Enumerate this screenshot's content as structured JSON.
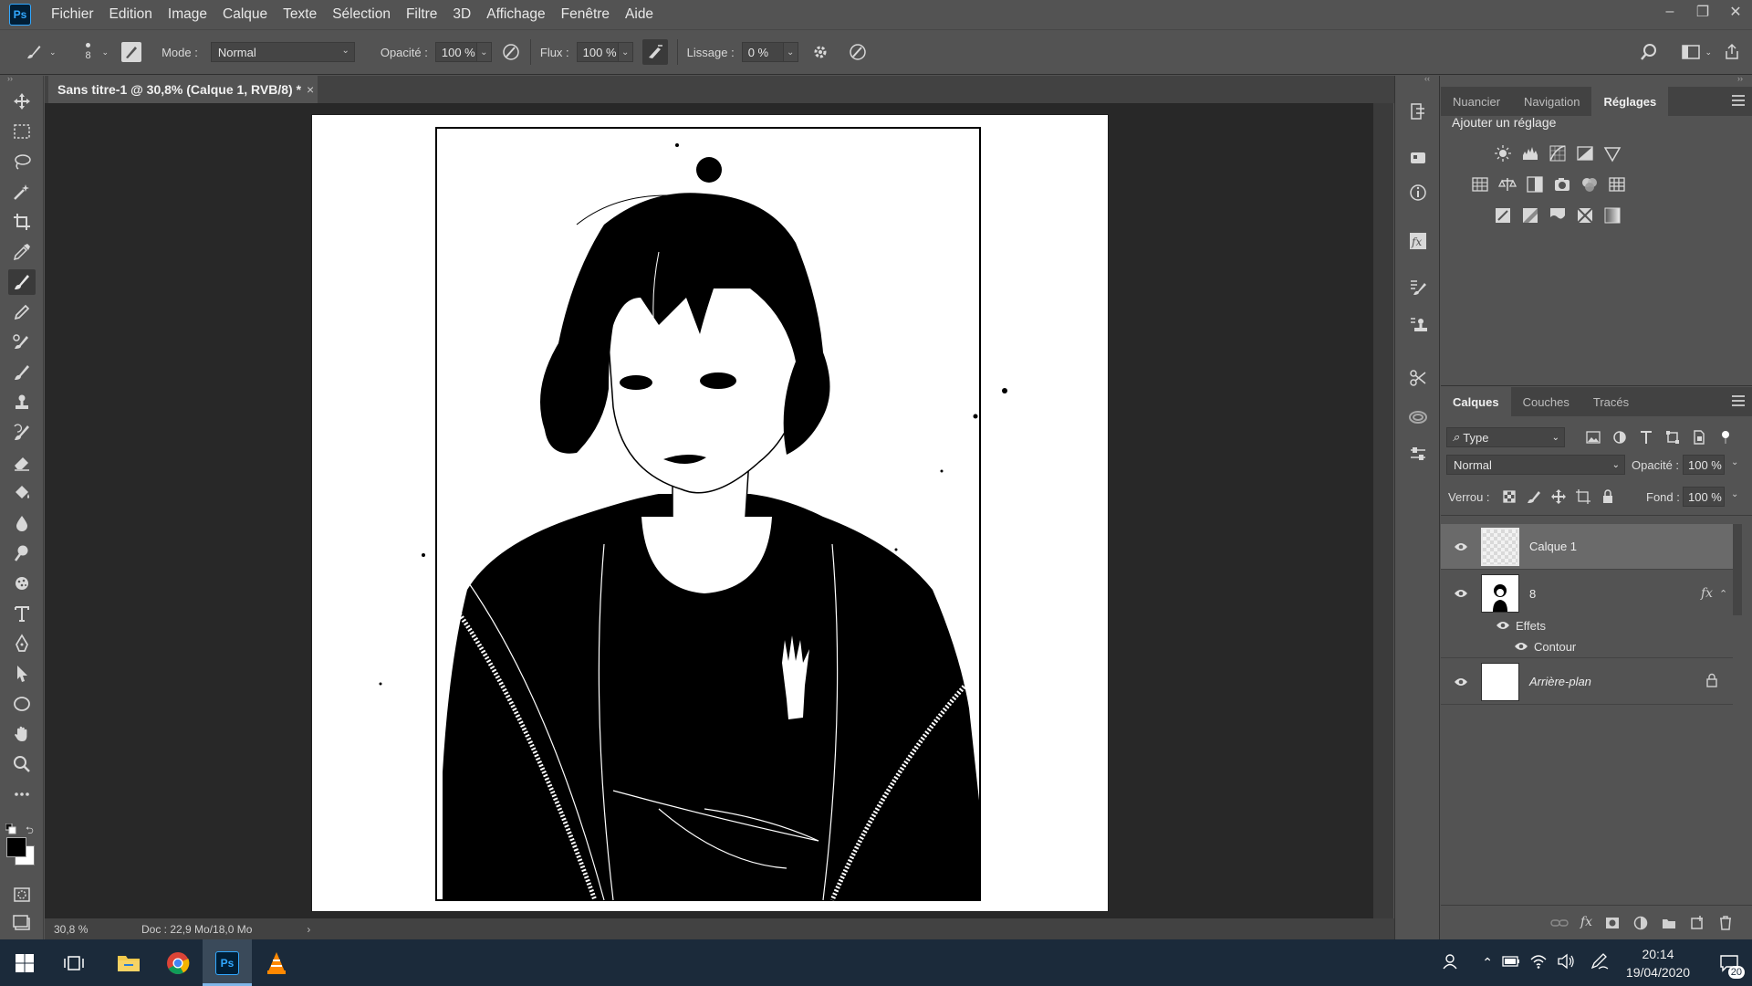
{
  "app": {
    "logo": "Ps"
  },
  "menu": [
    "Fichier",
    "Edition",
    "Image",
    "Calque",
    "Texte",
    "Sélection",
    "Filtre",
    "3D",
    "Affichage",
    "Fenêtre",
    "Aide"
  ],
  "window_controls": {
    "minimize": "–",
    "restore": "❐",
    "close": "✕"
  },
  "options": {
    "brush_size": "8",
    "mode_label": "Mode :",
    "mode_value": "Normal",
    "opacity_label": "Opacité :",
    "opacity_value": "100 %",
    "flow_label": "Flux :",
    "flow_value": "100 %",
    "smoothing_label": "Lissage :",
    "smoothing_value": "0 %"
  },
  "document": {
    "tab_title": "Sans titre-1 @ 30,8% (Calque 1, RVB/8) *",
    "close": "×"
  },
  "status": {
    "zoom": "30,8 %",
    "doc_info": "Doc : 22,9 Mo/18,0 Mo",
    "arrow": "›"
  },
  "adjustments_panel": {
    "tabs": [
      "Nuancier",
      "Navigation",
      "Réglages"
    ],
    "active_tab": "Réglages",
    "title": "Ajouter un réglage"
  },
  "layers_panel": {
    "tabs": [
      "Calques",
      "Couches",
      "Tracés"
    ],
    "active_tab": "Calques",
    "filter": "Type",
    "blend_mode": "Normal",
    "opacity_label": "Opacité :",
    "opacity_value": "100 %",
    "lock_label": "Verrou :",
    "fill_label": "Fond :",
    "fill_value": "100 %",
    "layers": [
      {
        "name": "Calque 1",
        "selected": true
      },
      {
        "name": "8",
        "fx": "fx",
        "effects_label": "Effets",
        "effect": "Contour"
      },
      {
        "name": "Arrière-plan",
        "locked": true
      }
    ]
  },
  "taskbar": {
    "time": "20:14",
    "date": "19/04/2020",
    "notifications": "20"
  },
  "colors": {
    "ui_bg": "#535353",
    "canvas_bg": "#282828",
    "taskbar_bg": "#1b2a3a",
    "selected_layer": "#6a6a6a",
    "ps_blue": "#31a8ff"
  }
}
